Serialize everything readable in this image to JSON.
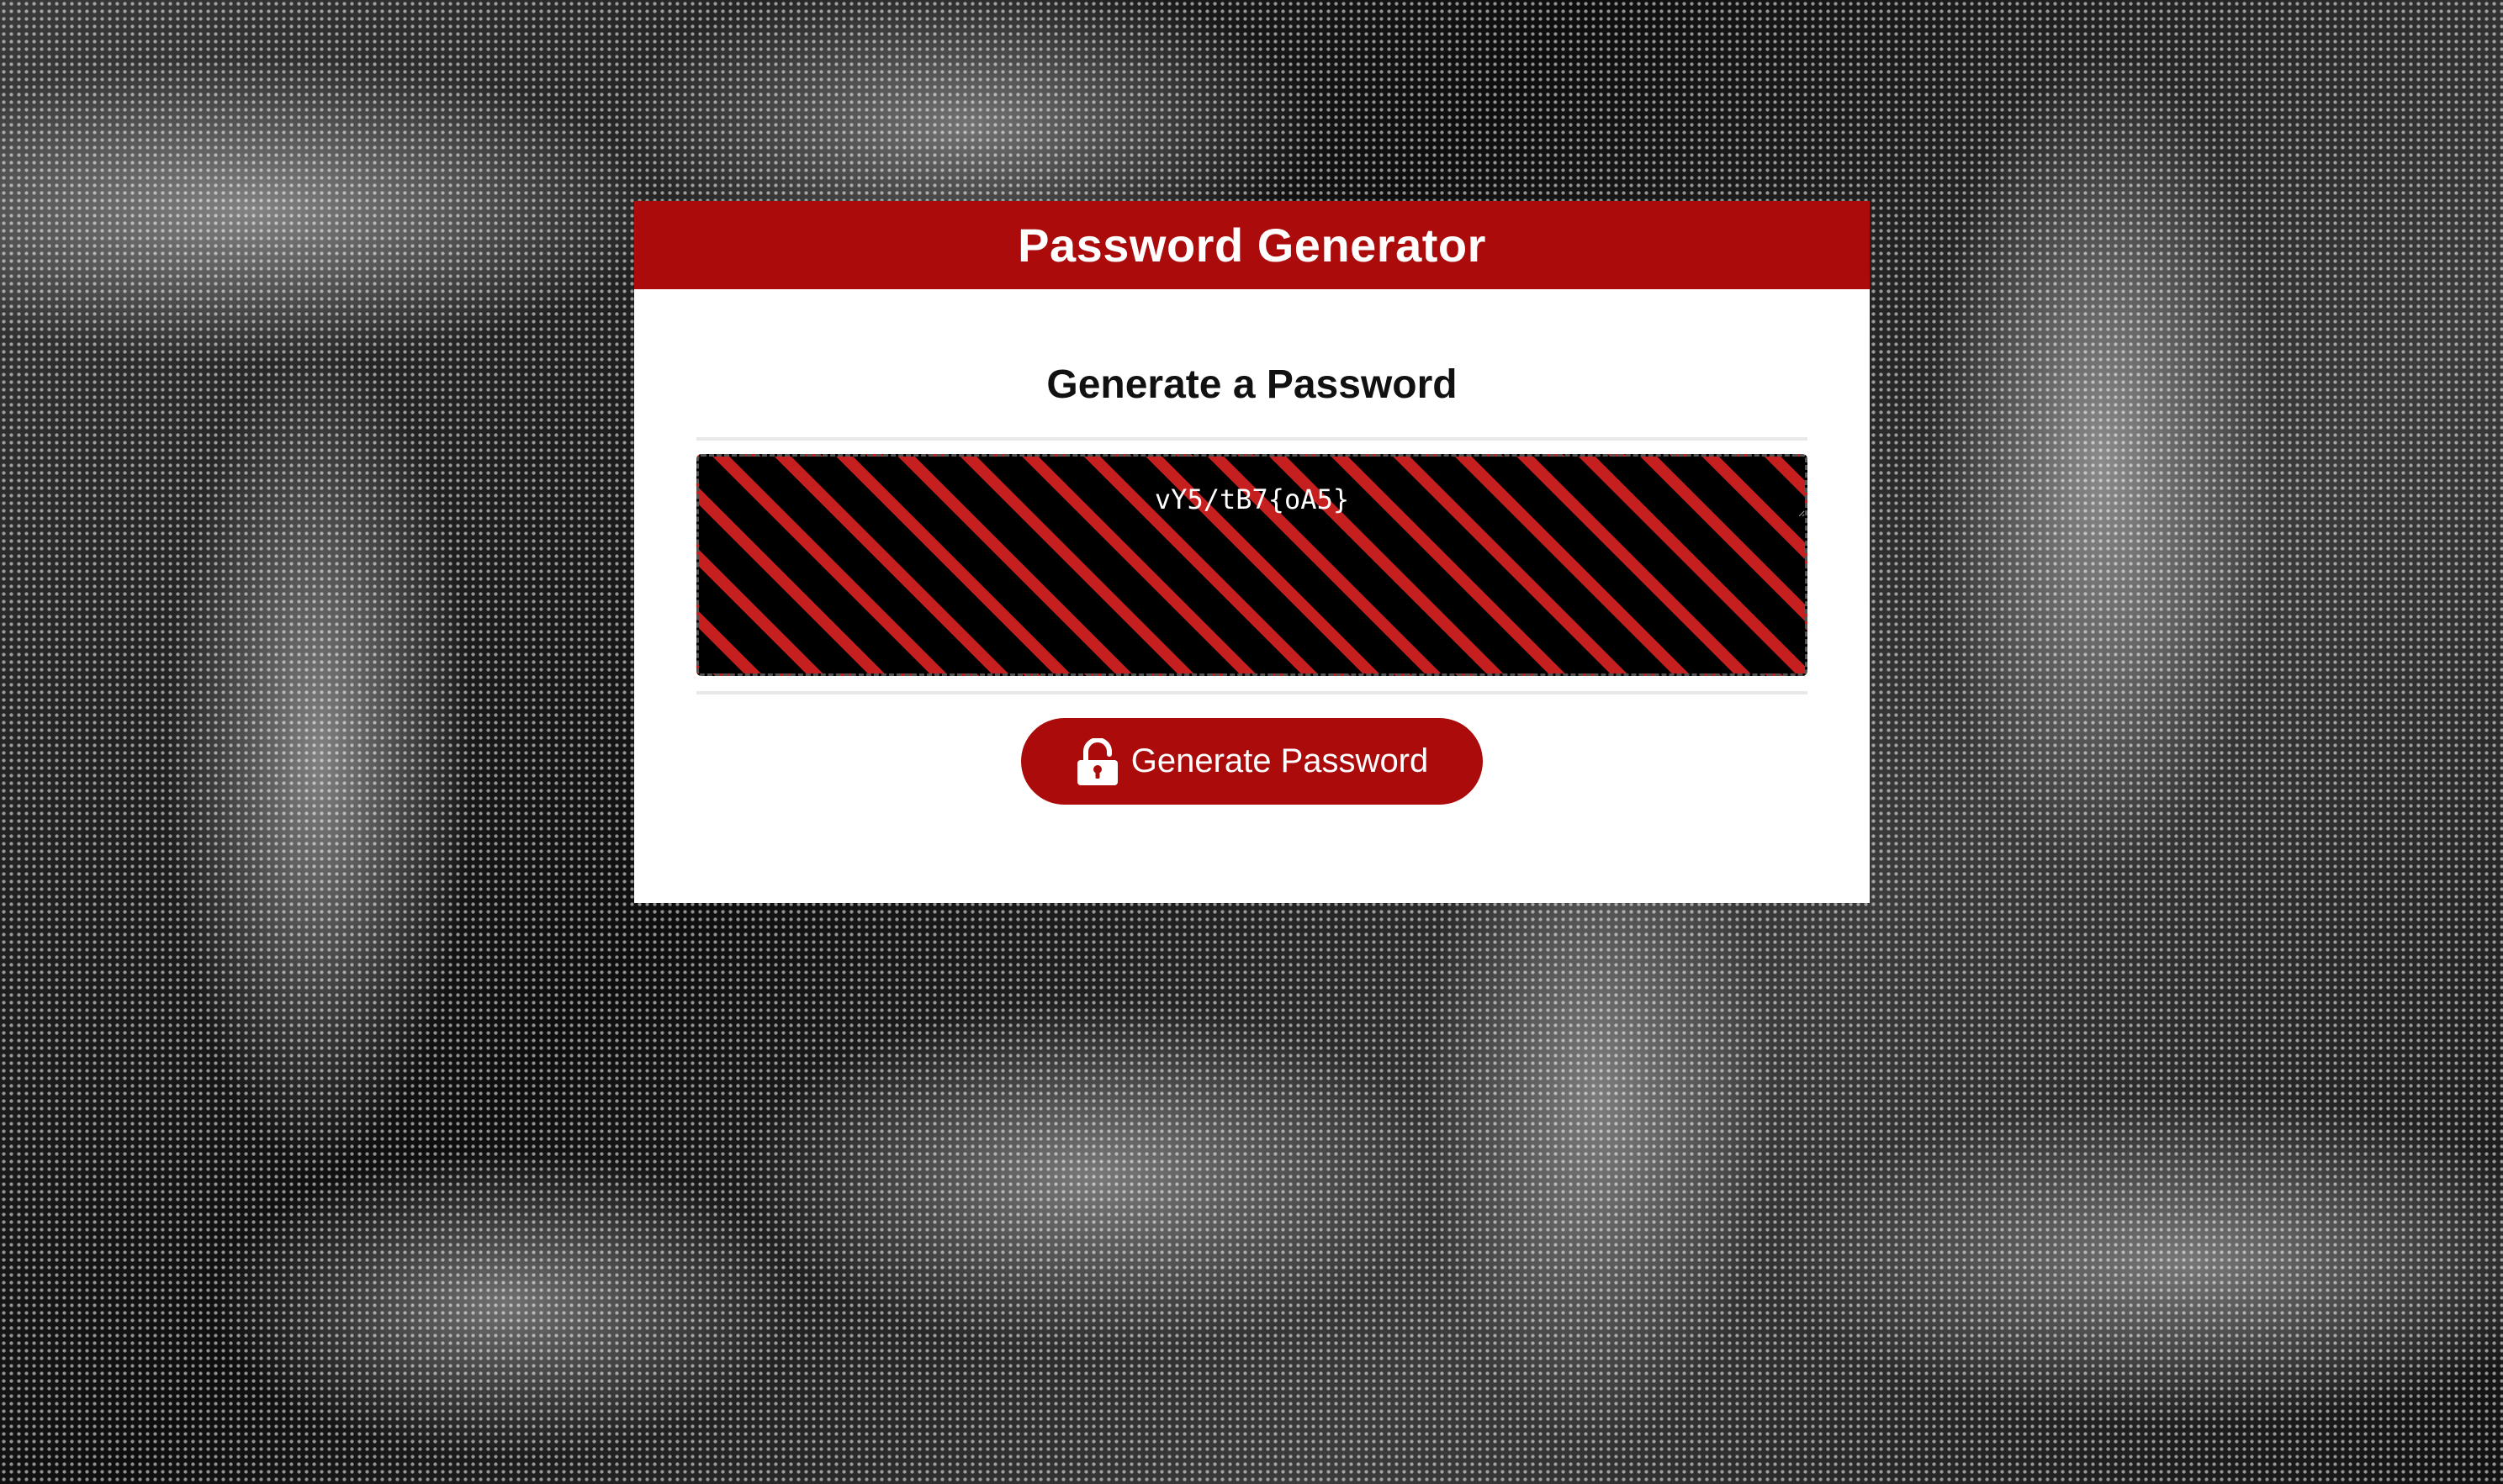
{
  "app": {
    "header_title": "Password Generator",
    "subtitle": "Generate a Password"
  },
  "password": {
    "value": "vY5/tB7{oA5}",
    "placeholder": ""
  },
  "actions": {
    "generate_label": "Generate Password",
    "generate_icon": "unlock-icon"
  },
  "colors": {
    "brand_red": "#ab0b0b",
    "stripe_red": "#c61f1f",
    "stripe_black": "#000000"
  }
}
